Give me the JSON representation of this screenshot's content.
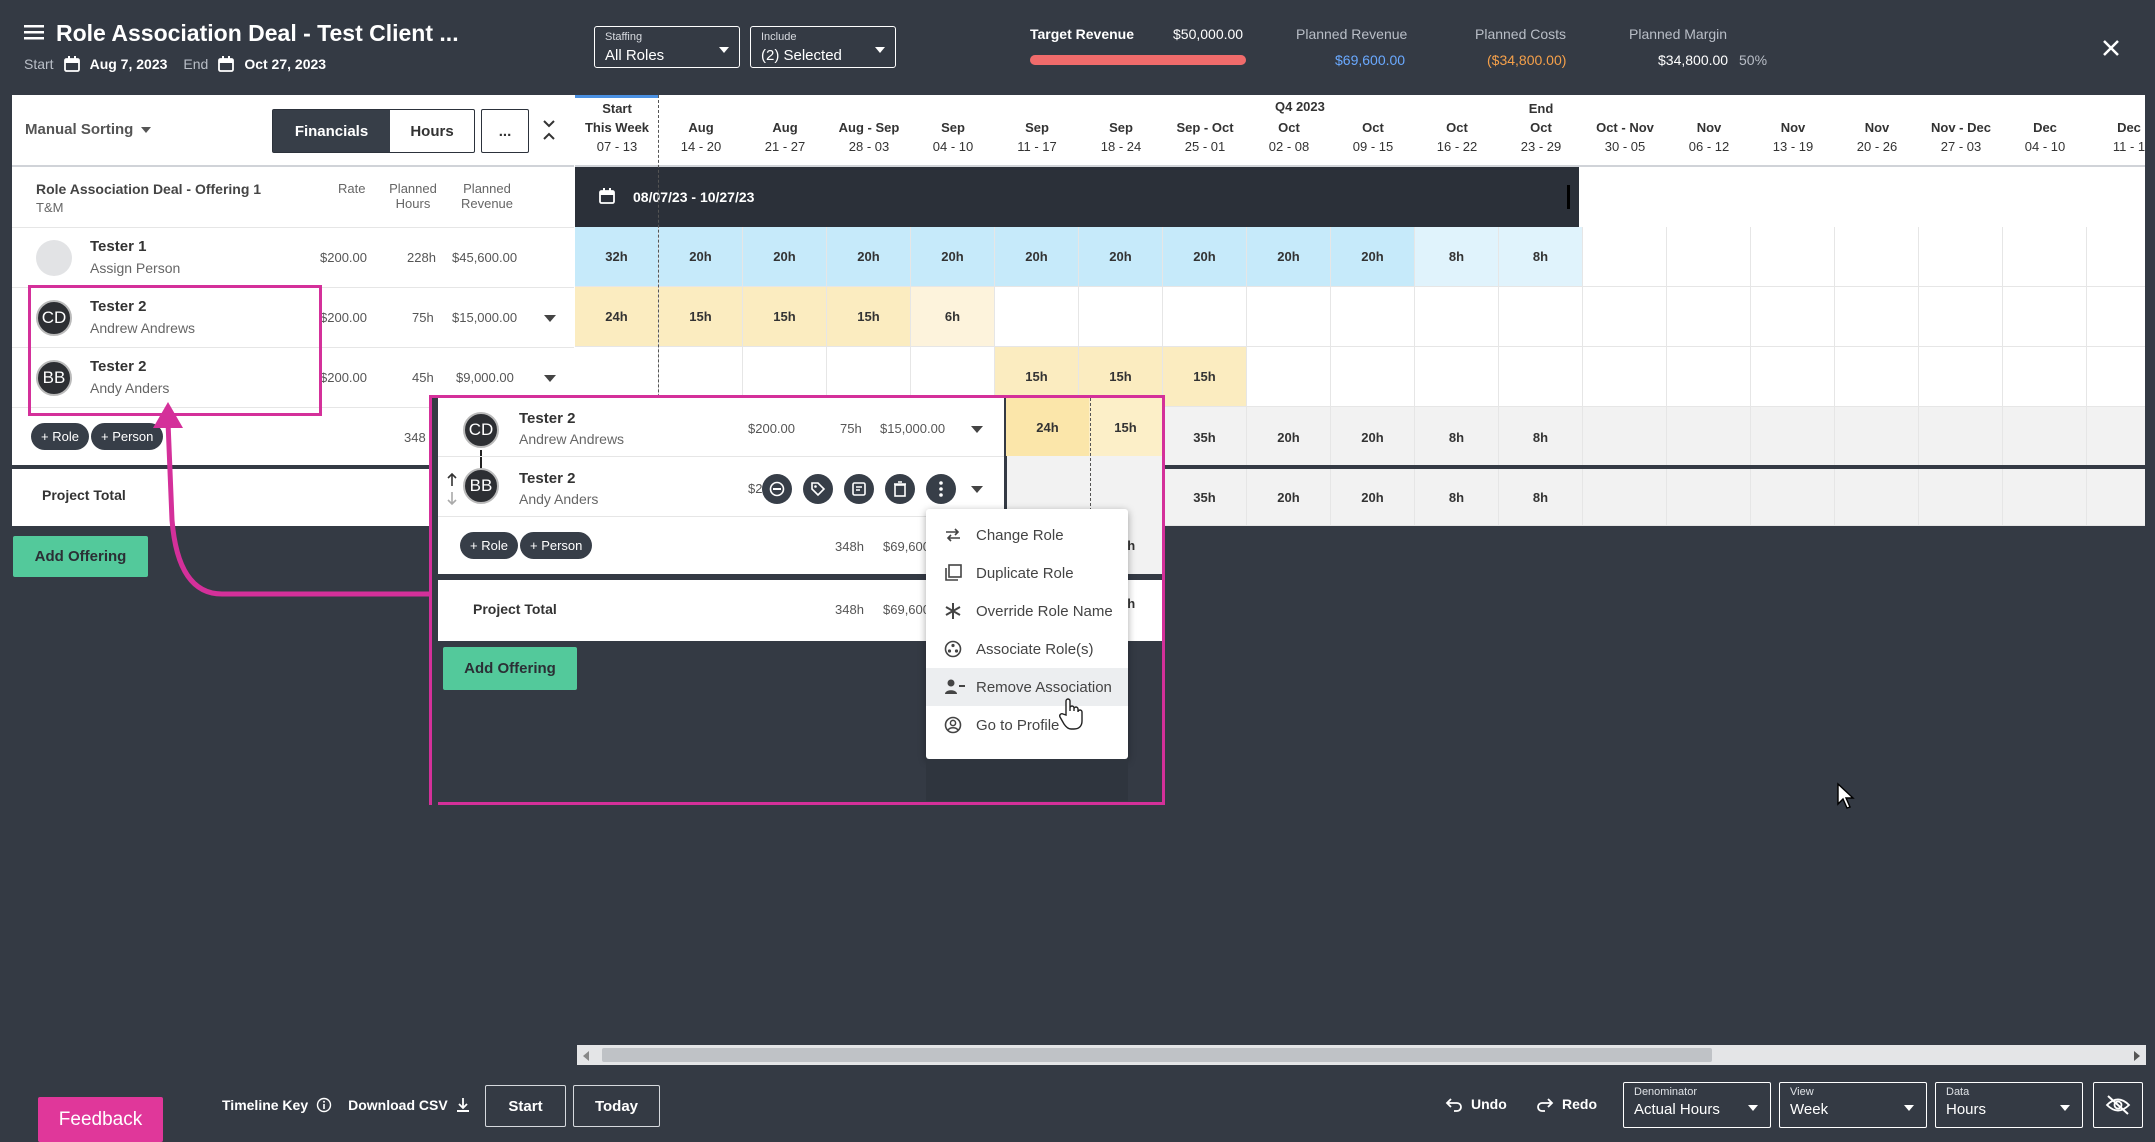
{
  "header": {
    "title": "Role Association Deal - Test Client ...",
    "start_label": "Start",
    "start_date": "Aug 7, 2023",
    "end_label": "End",
    "end_date": "Oct 27, 2023",
    "staffing": {
      "label": "Staffing",
      "value": "All Roles"
    },
    "include": {
      "label": "Include",
      "value": "(2) Selected"
    },
    "target_revenue_label": "Target Revenue",
    "target_revenue": "$50,000.00",
    "planned_revenue_label": "Planned Revenue",
    "planned_revenue": "$69,600.00",
    "planned_costs_label": "Planned Costs",
    "planned_costs": "($34,800.00)",
    "planned_margin_label": "Planned Margin",
    "planned_margin": "$34,800.00",
    "planned_margin_pct": "50%",
    "target_progress": 1.0,
    "colors": {
      "revenue": "#6aa9ff",
      "costs": "#f5a04a",
      "target_bar": "#f06b6b"
    }
  },
  "toolbar": {
    "sorting": "Manual Sorting",
    "financials": "Financials",
    "hours": "Hours",
    "more": "..."
  },
  "offering": {
    "name": "Role Association Deal - Offering 1",
    "type": "T&M",
    "col_rate": "Rate",
    "col_hours": "Planned Hours",
    "col_revenue": "Planned Revenue"
  },
  "rows": [
    {
      "name": "Tester 1",
      "sub": "Assign Person",
      "rate": "$200.00",
      "hours": "228h",
      "revenue": "$45,600.00",
      "initials": ""
    },
    {
      "name": "Tester 2",
      "sub": "Andrew Andrews",
      "rate": "$200.00",
      "hours": "75h",
      "revenue": "$15,000.00",
      "initials": "CD"
    },
    {
      "name": "Tester 2",
      "sub": "Andy Anders",
      "rate": "$200.00",
      "hours": "45h",
      "revenue": "$9,000.00",
      "initials": "BB"
    }
  ],
  "add_role": "+ Role",
  "add_person": "+ Person",
  "subtotal_hours": "348",
  "project_total": "Project Total",
  "project_total_hours": "348",
  "add_offering": "Add Offering",
  "timeline": {
    "q4": "Q4 2023",
    "range": "08/07/23 - 10/27/23",
    "columns": [
      {
        "top": "Start",
        "mid": "This Week",
        "bot": "07 - 13"
      },
      {
        "top": "",
        "mid": "Aug",
        "bot": "14 - 20"
      },
      {
        "top": "",
        "mid": "Aug",
        "bot": "21 - 27"
      },
      {
        "top": "",
        "mid": "Aug - Sep",
        "bot": "28 - 03"
      },
      {
        "top": "",
        "mid": "Sep",
        "bot": "04 - 10"
      },
      {
        "top": "",
        "mid": "Sep",
        "bot": "11 - 17"
      },
      {
        "top": "",
        "mid": "Sep",
        "bot": "18 - 24"
      },
      {
        "top": "",
        "mid": "Sep - Oct",
        "bot": "25 - 01"
      },
      {
        "top": "",
        "mid": "Oct",
        "bot": "02 - 08"
      },
      {
        "top": "",
        "mid": "Oct",
        "bot": "09 - 15"
      },
      {
        "top": "",
        "mid": "Oct",
        "bot": "16 - 22"
      },
      {
        "top": "End",
        "mid": "Oct",
        "bot": "23 - 29"
      },
      {
        "top": "",
        "mid": "Oct - Nov",
        "bot": "30 - 05"
      },
      {
        "top": "",
        "mid": "Nov",
        "bot": "06 - 12"
      },
      {
        "top": "",
        "mid": "Nov",
        "bot": "13 - 19"
      },
      {
        "top": "",
        "mid": "Nov",
        "bot": "20 - 26"
      },
      {
        "top": "",
        "mid": "Nov - Dec",
        "bot": "27 - 03"
      },
      {
        "top": "",
        "mid": "Dec",
        "bot": "04 - 10"
      },
      {
        "top": "",
        "mid": "Dec",
        "bot": "11 - 1"
      }
    ],
    "row1": [
      "32h",
      "20h",
      "20h",
      "20h",
      "20h",
      "20h",
      "20h",
      "20h",
      "20h",
      "20h",
      "8h",
      "8h"
    ],
    "row2": [
      "24h",
      "15h",
      "15h",
      "15h",
      "6h"
    ],
    "row3": [
      "15h",
      "15h",
      "15h"
    ],
    "subtotal": [
      "35h",
      "20h",
      "20h",
      "8h",
      "8h"
    ],
    "total": [
      "35h",
      "20h",
      "20h",
      "8h",
      "8h"
    ]
  },
  "zoom": {
    "rows": [
      {
        "name": "Tester 2",
        "sub": "Andrew Andrews",
        "rate": "$200.00",
        "hours": "75h",
        "revenue": "$15,000.00",
        "initials": "CD"
      },
      {
        "name": "Tester 2",
        "sub": "Andy Anders",
        "rate": "$2",
        "initials": "BB"
      }
    ],
    "cells_row1": [
      "24h",
      "15h"
    ],
    "subtotal_hours": "348h",
    "subtotal_rev": "$69,600",
    "total_hours": "348h",
    "total_rev": "$69,600",
    "partial1": "5h",
    "partial2": "5h",
    "partial3": "35h"
  },
  "menu": [
    {
      "label": "Change Role",
      "icon": "swap-icon"
    },
    {
      "label": "Duplicate Role",
      "icon": "duplicate-icon"
    },
    {
      "label": "Override Role Name",
      "icon": "asterisk-icon"
    },
    {
      "label": "Associate Role(s)",
      "icon": "associate-icon"
    },
    {
      "label": "Remove Association",
      "icon": "remove-person-icon"
    },
    {
      "label": "Go to Profile",
      "icon": "profile-icon"
    }
  ],
  "footer": {
    "feedback": "Feedback",
    "timeline_key": "Timeline Key",
    "download_csv": "Download CSV",
    "start": "Start",
    "today": "Today",
    "undo": "Undo",
    "redo": "Redo",
    "denominator": {
      "label": "Denominator",
      "value": "Actual Hours"
    },
    "view": {
      "label": "View",
      "value": "Week"
    },
    "data": {
      "label": "Data",
      "value": "Hours"
    }
  }
}
